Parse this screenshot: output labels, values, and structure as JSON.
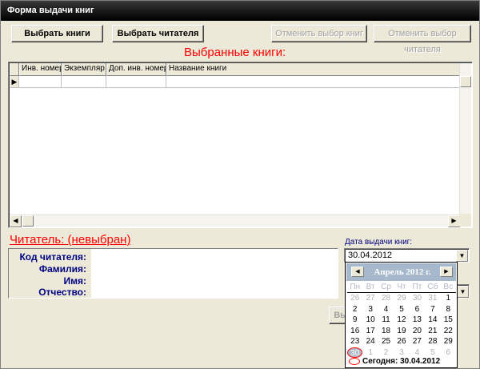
{
  "window": {
    "title": "Форма выдачи книг"
  },
  "toolbar": {
    "select_books": "Выбрать книги",
    "select_reader": "Выбрать читателя",
    "cancel_books": "Отменить выбор книг",
    "cancel_reader": "Отменить выбор читателя"
  },
  "books_section": {
    "title": "Выбранные книги:"
  },
  "grid": {
    "columns": [
      "Инв. номер",
      "Экземпляр",
      "Доп. инв. номер",
      "Название книги"
    ],
    "row_indicator": "▶"
  },
  "reader": {
    "title": "Читатель: (невыбран)",
    "fields": {
      "code": "Код читателя:",
      "last_name": "Фамилия:",
      "first_name": "Имя:",
      "patronymic": "Отчество:"
    }
  },
  "issue_date": {
    "label": "Дата выдачи книг:",
    "value": "30.04.2012"
  },
  "partial_button_label": "Вы",
  "calendar": {
    "month_label": "Апрель 2012 г.",
    "weekdays": [
      "Пн",
      "Вт",
      "Ср",
      "Чт",
      "Пт",
      "Сб",
      "Вс"
    ],
    "days": [
      {
        "d": "26",
        "m": true
      },
      {
        "d": "27",
        "m": true
      },
      {
        "d": "28",
        "m": true
      },
      {
        "d": "29",
        "m": true
      },
      {
        "d": "30",
        "m": true
      },
      {
        "d": "31",
        "m": true
      },
      {
        "d": "1",
        "m": false
      },
      {
        "d": "2",
        "m": false
      },
      {
        "d": "3",
        "m": false
      },
      {
        "d": "4",
        "m": false
      },
      {
        "d": "5",
        "m": false
      },
      {
        "d": "6",
        "m": false
      },
      {
        "d": "7",
        "m": false
      },
      {
        "d": "8",
        "m": false
      },
      {
        "d": "9",
        "m": false
      },
      {
        "d": "10",
        "m": false
      },
      {
        "d": "11",
        "m": false
      },
      {
        "d": "12",
        "m": false
      },
      {
        "d": "13",
        "m": false
      },
      {
        "d": "14",
        "m": false
      },
      {
        "d": "15",
        "m": false
      },
      {
        "d": "16",
        "m": false
      },
      {
        "d": "17",
        "m": false
      },
      {
        "d": "18",
        "m": false
      },
      {
        "d": "19",
        "m": false
      },
      {
        "d": "20",
        "m": false
      },
      {
        "d": "21",
        "m": false
      },
      {
        "d": "22",
        "m": false
      },
      {
        "d": "23",
        "m": false
      },
      {
        "d": "24",
        "m": false
      },
      {
        "d": "25",
        "m": false
      },
      {
        "d": "26",
        "m": false
      },
      {
        "d": "27",
        "m": false
      },
      {
        "d": "28",
        "m": false
      },
      {
        "d": "29",
        "m": false
      },
      {
        "d": "30",
        "m": false,
        "selected": true
      },
      {
        "d": "1",
        "m": true
      },
      {
        "d": "2",
        "m": true
      },
      {
        "d": "3",
        "m": true
      },
      {
        "d": "4",
        "m": true
      },
      {
        "d": "5",
        "m": true
      },
      {
        "d": "6",
        "m": true
      }
    ],
    "today_label": "Сегодня: 30.04.2012"
  },
  "icons": {
    "prev": "triangle-left",
    "next": "triangle-right",
    "dropdown": "triangle-down"
  },
  "colors": {
    "accent_red": "#ff0000",
    "label_navy": "#000080",
    "calendar_header": "#a6b8cc"
  }
}
